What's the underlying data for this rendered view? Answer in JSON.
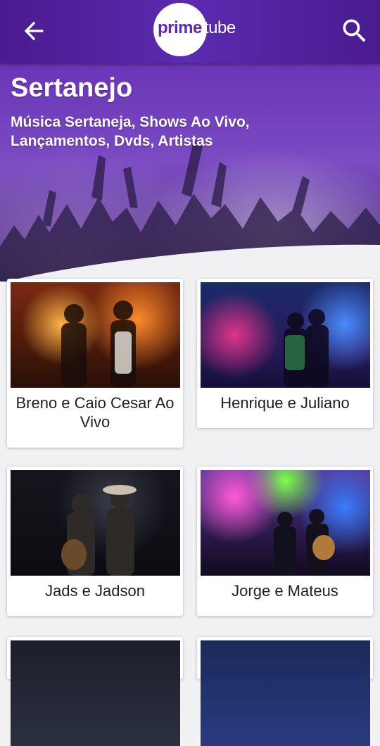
{
  "appbar": {
    "logo_prime": "prime",
    "logo_tube": "tube",
    "back_icon": "arrow-left-icon",
    "search_icon": "search-icon",
    "bg_color": "#5b2bb0"
  },
  "hero": {
    "title": "Sertanejo",
    "subtitle": "Música Sertaneja, Shows Ao Vivo, Lançamentos, Dvds, Artistas"
  },
  "cards": [
    {
      "title": "Breno e Caio Cesar Ao Vivo"
    },
    {
      "title": "Henrique e Juliano"
    },
    {
      "title": "Jads e Jadson"
    },
    {
      "title": "Jorge e Mateus"
    }
  ]
}
